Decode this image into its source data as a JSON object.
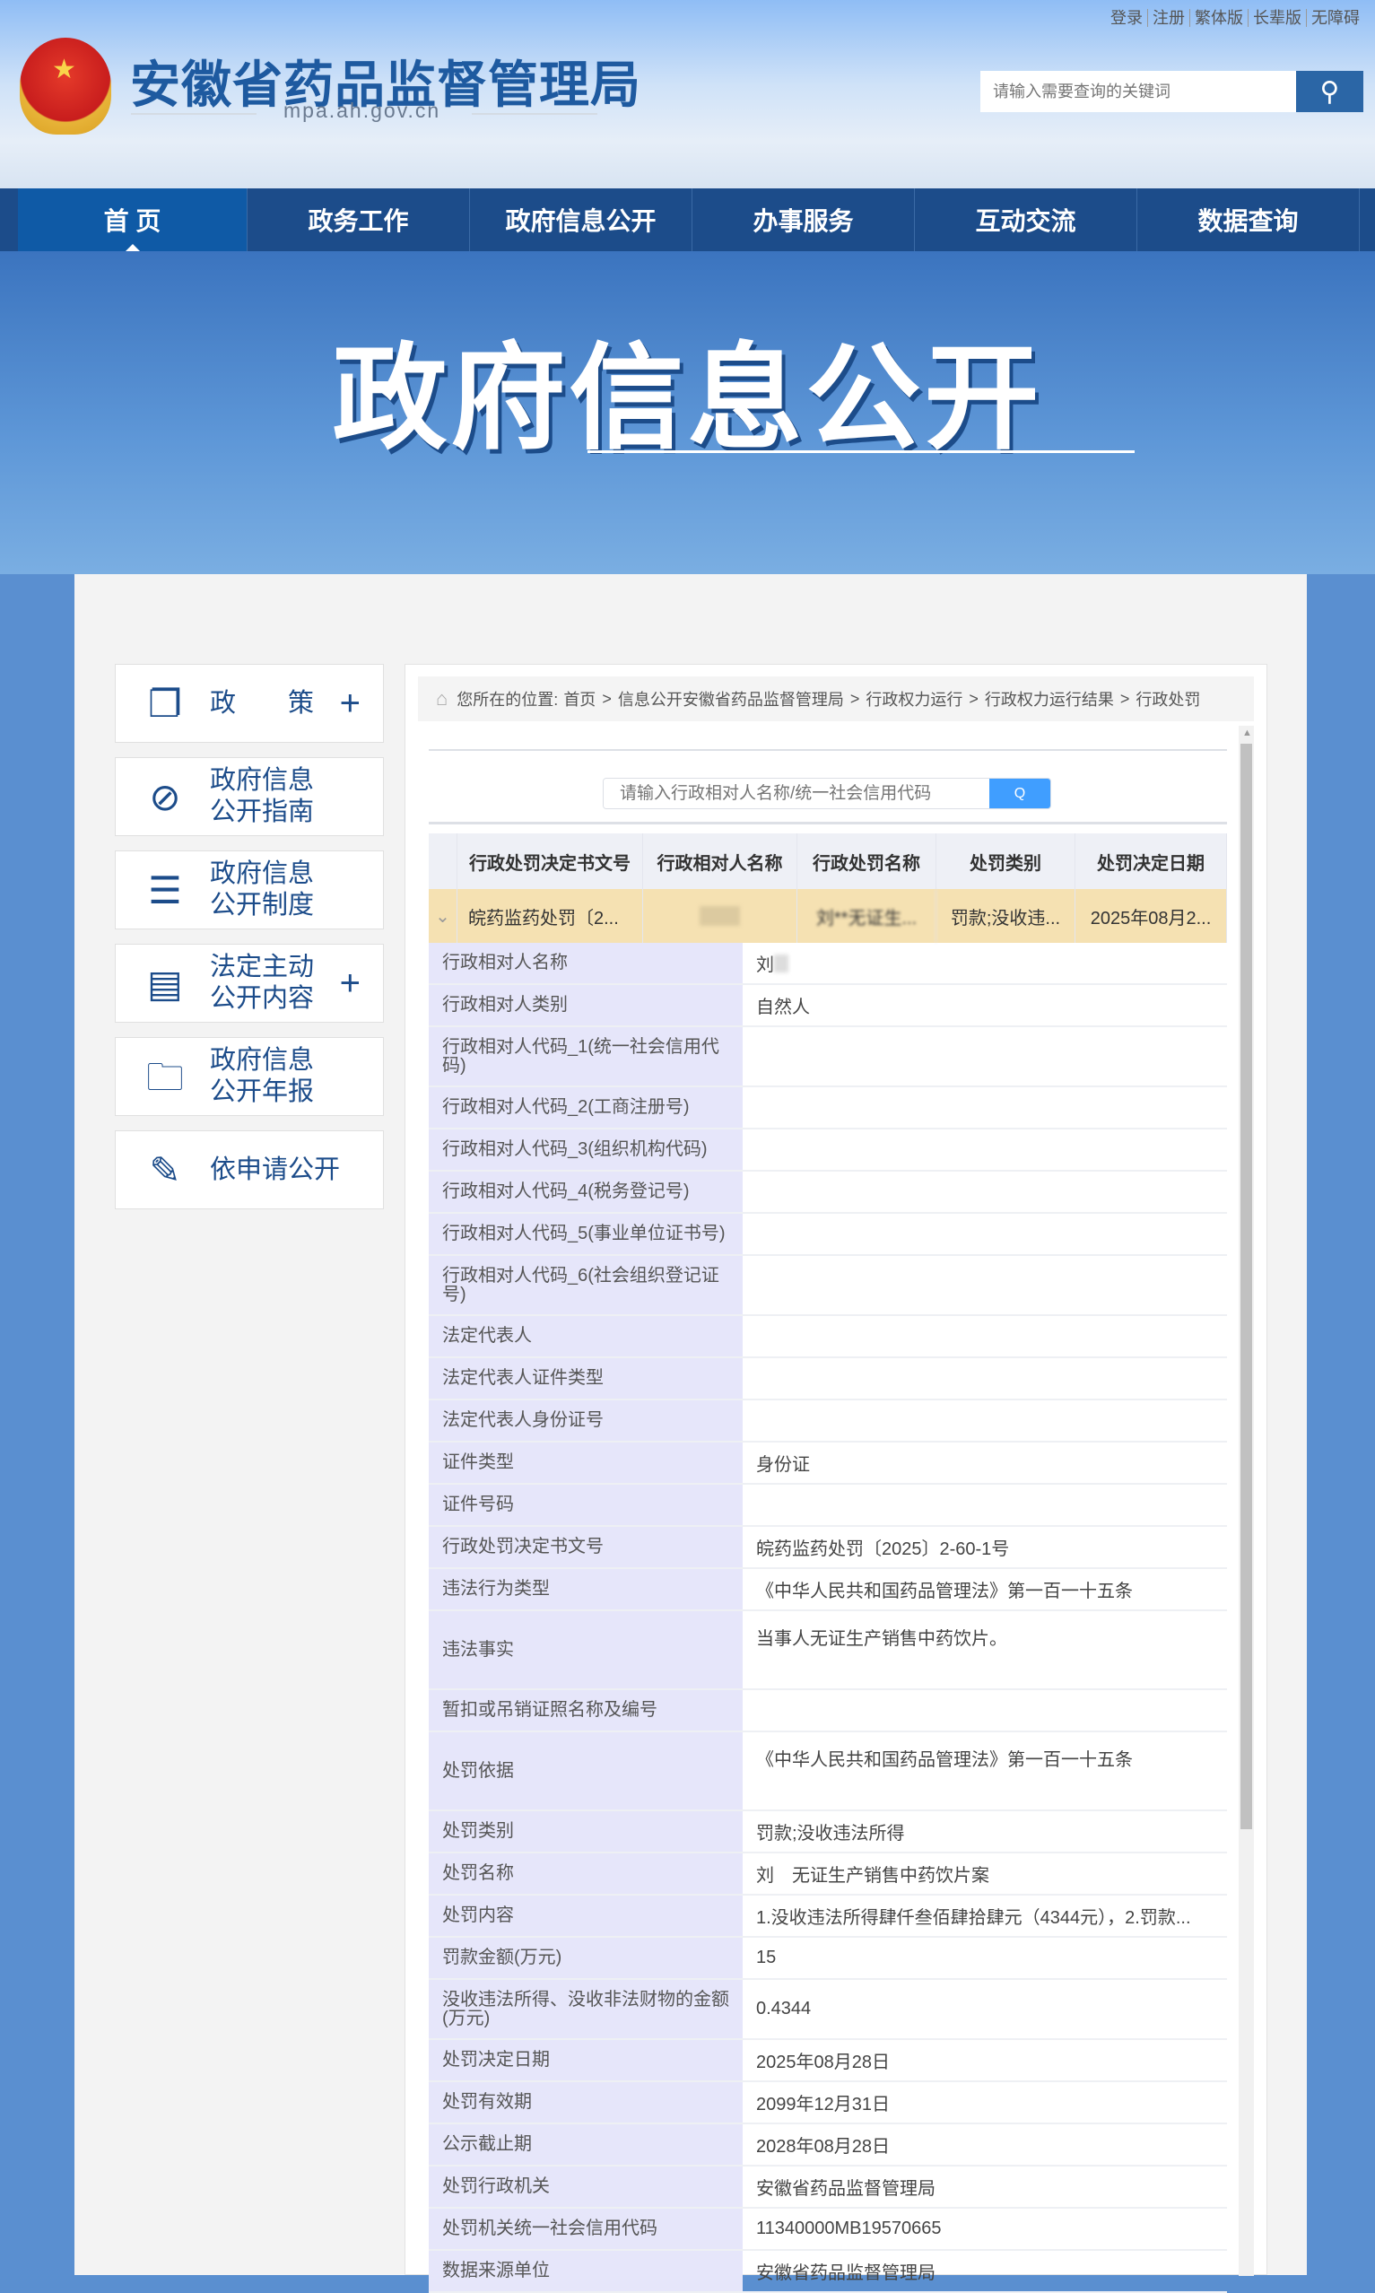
{
  "header": {
    "top_links": [
      "登录",
      "注册",
      "繁体版",
      "长辈版",
      "无障碍"
    ],
    "site_name": "安徽省药品监督管理局",
    "site_url": "mpa.ah.gov.cn",
    "search_placeholder": "请输入需要查询的关键词"
  },
  "nav": [
    "首 页",
    "政务工作",
    "政府信息公开",
    "办事服务",
    "互动交流",
    "数据查询"
  ],
  "banner_title": "政府信息公开",
  "sidebar": [
    {
      "label": "政　　策",
      "icon": "document-stack-icon",
      "plus": "+"
    },
    {
      "label": "政府信息\n公开指南",
      "icon": "compass-icon"
    },
    {
      "label": "政府信息\n公开制度",
      "icon": "list-icon"
    },
    {
      "label": "法定主动\n公开内容",
      "icon": "clipboard-icon",
      "plus": "+"
    },
    {
      "label": "政府信息\n公开年报",
      "icon": "folder-icon"
    },
    {
      "label": "依申请公开",
      "icon": "edit-icon"
    }
  ],
  "breadcrumb": {
    "prefix": "您所在的位置:",
    "items": [
      "首页",
      "信息公开安徽省药品监督管理局",
      "行政权力运行",
      "行政权力运行结果",
      "行政处罚"
    ]
  },
  "query": {
    "placeholder": "请输入行政相对人名称/统一社会信用代码"
  },
  "table": {
    "headers": [
      "行政处罚决定书文号",
      "行政相对人名称",
      "行政处罚名称",
      "处罚类别",
      "处罚决定日期"
    ],
    "row": [
      "皖药监药处罚〔2...",
      "",
      "刘**无证生...",
      "罚款;没收违...",
      "2025年08月2..."
    ],
    "expand": "⌄"
  },
  "details": [
    [
      "行政相对人名称",
      "刘"
    ],
    [
      "行政相对人类别",
      "自然人"
    ],
    [
      "行政相对人代码_1(统一社会信用代码)",
      ""
    ],
    [
      "行政相对人代码_2(工商注册号)",
      ""
    ],
    [
      "行政相对人代码_3(组织机构代码)",
      ""
    ],
    [
      "行政相对人代码_4(税务登记号)",
      ""
    ],
    [
      "行政相对人代码_5(事业单位证书号)",
      ""
    ],
    [
      "行政相对人代码_6(社会组织登记证号)",
      ""
    ],
    [
      "法定代表人",
      ""
    ],
    [
      "法定代表人证件类型",
      ""
    ],
    [
      "法定代表人身份证号",
      ""
    ],
    [
      "证件类型",
      "身份证"
    ],
    [
      "证件号码",
      ""
    ],
    [
      "行政处罚决定书文号",
      "皖药监药处罚〔2025〕2-60-1号"
    ],
    [
      "违法行为类型",
      "《中华人民共和国药品管理法》第一百一十五条"
    ],
    [
      "违法事实",
      "当事人无证生产销售中药饮片。"
    ],
    [
      "暂扣或吊销证照名称及编号",
      ""
    ],
    [
      "处罚依据",
      "《中华人民共和国药品管理法》第一百一十五条"
    ],
    [
      "处罚类别",
      "罚款;没收违法所得"
    ],
    [
      "处罚名称",
      "刘　无证生产销售中药饮片案"
    ],
    [
      "处罚内容",
      "1.没收违法所得肆仟叁佰肆拾肆元（4344元），2.罚款..."
    ],
    [
      "罚款金额(万元)",
      "15"
    ],
    [
      "没收违法所得、没收非法财物的金额(万元)",
      "0.4344"
    ],
    [
      "处罚决定日期",
      "2025年08月28日"
    ],
    [
      "处罚有效期",
      "2099年12月31日"
    ],
    [
      "公示截止期",
      "2028年08月28日"
    ],
    [
      "处罚行政机关",
      "安徽省药品监督管理局"
    ],
    [
      "处罚机关统一社会信用代码",
      "11340000MB19570665"
    ],
    [
      "数据来源单位",
      "安徽省药品监督管理局"
    ]
  ]
}
